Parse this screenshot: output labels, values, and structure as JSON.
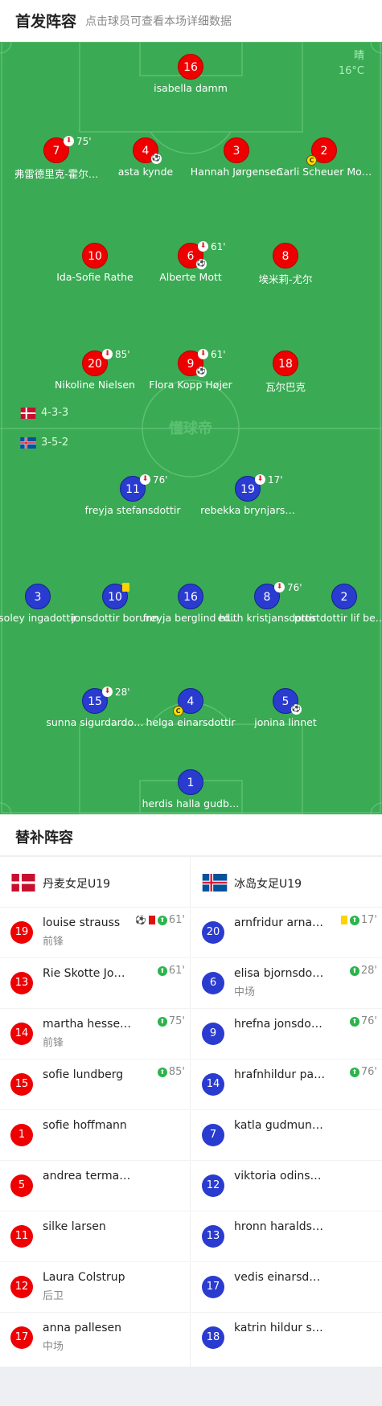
{
  "header": {
    "title": "首发阵容",
    "subtitle": "点击球员可查看本场详细数据"
  },
  "weather": {
    "condition": "晴",
    "temp": "16°C"
  },
  "watermark": "懂球帝",
  "home": {
    "formation": "4-3-3",
    "players": [
      {
        "num": "16",
        "name": "isabella damm"
      },
      {
        "num": "7",
        "name": "弗雷德里克-霍尔…",
        "sub": "75'"
      },
      {
        "num": "4",
        "name": "asta kynde",
        "ball": true
      },
      {
        "num": "3",
        "name": "Hannah Jørgensen"
      },
      {
        "num": "2",
        "name": "Carli Scheuer Mo…",
        "captain": true
      },
      {
        "num": "10",
        "name": "Ida-Sofie Rathe"
      },
      {
        "num": "6",
        "name": "Alberte Mott",
        "sub": "61'",
        "ball": true
      },
      {
        "num": "8",
        "name": "埃米莉-尤尔"
      },
      {
        "num": "20",
        "name": "Nikoline Nielsen",
        "sub": "85'"
      },
      {
        "num": "9",
        "name": "Flora Kopp Højer",
        "sub": "61'",
        "ball": true
      },
      {
        "num": "18",
        "name": "瓦尔巴克"
      }
    ]
  },
  "away": {
    "formation": "3-5-2",
    "players": [
      {
        "num": "11",
        "name": "freyja stefansdottir",
        "sub": "76'"
      },
      {
        "num": "19",
        "name": "rebekka brynjars…",
        "sub": "17'"
      },
      {
        "num": "3",
        "name": "soley ingadottir"
      },
      {
        "num": "10",
        "name": "jonsdottir borunn",
        "yellow": true
      },
      {
        "num": "16",
        "name": "freyja berglind hl…"
      },
      {
        "num": "8",
        "name": "edith kristjansdottir",
        "sub": "76'"
      },
      {
        "num": "2",
        "name": "prostdottir lif bem…"
      },
      {
        "num": "15",
        "name": "sunna sigurdardo…",
        "sub": "28'"
      },
      {
        "num": "4",
        "name": "helga einarsdottir",
        "captain": true
      },
      {
        "num": "5",
        "name": "jonina linnet",
        "ball": true
      },
      {
        "num": "1",
        "name": "herdis halla gudb…"
      }
    ]
  },
  "subs": {
    "title": "替补阵容",
    "home_team": "丹麦女足U19",
    "away_team": "冰岛女足U19",
    "home": [
      {
        "num": "19",
        "name": "louise strauss",
        "pos": "前锋",
        "time": "61'",
        "ball": true,
        "red": true
      },
      {
        "num": "13",
        "name": "Rie Skotte Jo…",
        "pos": "",
        "time": "61'"
      },
      {
        "num": "14",
        "name": "martha hesse…",
        "pos": "前锋",
        "time": "75'"
      },
      {
        "num": "15",
        "name": "sofie lundberg",
        "pos": "",
        "time": "85'"
      },
      {
        "num": "1",
        "name": "sofie hoffmann",
        "pos": "",
        "time": ""
      },
      {
        "num": "5",
        "name": "andrea terma…",
        "pos": "",
        "time": ""
      },
      {
        "num": "11",
        "name": "silke larsen",
        "pos": "",
        "time": ""
      },
      {
        "num": "12",
        "name": "Laura Colstrup",
        "pos": "后卫",
        "time": ""
      },
      {
        "num": "17",
        "name": "anna pallesen",
        "pos": "中场",
        "time": ""
      }
    ],
    "away": [
      {
        "num": "20",
        "name": "arnfridur arna…",
        "pos": "",
        "time": "17'",
        "yellow": true
      },
      {
        "num": "6",
        "name": "elisa bjornsdottir",
        "pos": "中场",
        "time": "28'"
      },
      {
        "num": "9",
        "name": "hrefna jonsdottir",
        "pos": "",
        "time": "76'"
      },
      {
        "num": "14",
        "name": "hrafnhildur pal…",
        "pos": "",
        "time": "76'"
      },
      {
        "num": "7",
        "name": "katla gudmun…",
        "pos": "",
        "time": ""
      },
      {
        "num": "12",
        "name": "viktoria odins…",
        "pos": "",
        "time": ""
      },
      {
        "num": "13",
        "name": "hronn haralds…",
        "pos": "",
        "time": ""
      },
      {
        "num": "17",
        "name": "vedis einarsd…",
        "pos": "",
        "time": ""
      },
      {
        "num": "18",
        "name": "katrin hildur s…",
        "pos": "",
        "time": ""
      }
    ]
  },
  "colors": {
    "pitch": "#3aaa54",
    "home": "#ee0000",
    "away": "#2a3bd0"
  }
}
